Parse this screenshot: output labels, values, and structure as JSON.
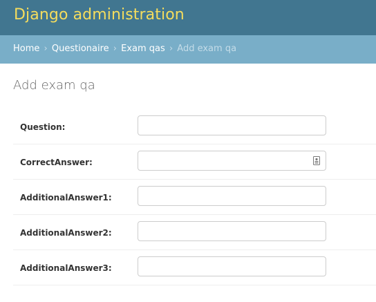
{
  "header": {
    "brand": "Django administration"
  },
  "breadcrumbs": {
    "home": "Home",
    "app": "Questionaire",
    "model": "Exam qas",
    "current": "Add exam qa",
    "separator": "›"
  },
  "page": {
    "title": "Add exam qa"
  },
  "form": {
    "fields": [
      {
        "label": "Question:",
        "value": ""
      },
      {
        "label": "CorrectAnswer:",
        "value": "",
        "icon": "contact-card-icon"
      },
      {
        "label": "AdditionalAnswer1:",
        "value": ""
      },
      {
        "label": "AdditionalAnswer2:",
        "value": ""
      },
      {
        "label": "AdditionalAnswer3:",
        "value": ""
      }
    ]
  },
  "colors": {
    "header_bg": "#417690",
    "brand": "#f5dd5d",
    "breadcrumb_bg": "#79aec8",
    "breadcrumb_current": "#c4dce8",
    "title_text": "#666666",
    "label_text": "#333333",
    "input_border": "#cccccc"
  }
}
